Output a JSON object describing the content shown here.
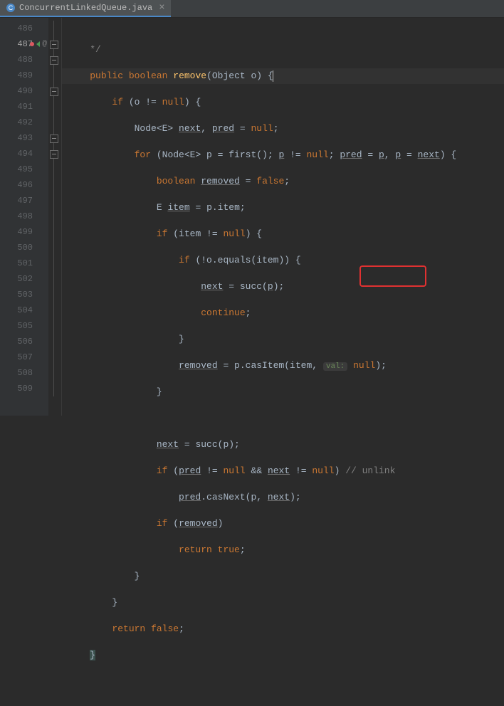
{
  "tab": {
    "filename": "ConcurrentLinkedQueue.java"
  },
  "gutter": {
    "start": 486,
    "end": 509,
    "highlight": 487
  },
  "code": {
    "l486": "*/",
    "l487_kw1": "public",
    "l487_kw2": "boolean",
    "l487_mtd": "remove",
    "l487_sig": "(Object o) {",
    "l488_kw": "if",
    "l488_cond": "(o != ",
    "l488_null": "null",
    "l488_end": ") {",
    "l489_ty": "Node<E>",
    "l489_v1": "next",
    "l489_v2": "pred",
    "l489_null": "null",
    "l490_kw": "for",
    "l490_ty": "Node<E>",
    "l490_rest1": " p = first(); ",
    "l490_p": "p",
    "l490_rest2": " != ",
    "l490_null": "null",
    "l490_rest3": "; ",
    "l490_pred": "pred",
    "l490_eq1": " = ",
    "l490_pval": "p",
    "l490_c2": ", ",
    "l490_pvar": "p",
    "l490_eq2": " = ",
    "l490_next": "next",
    "l490_end": ") {",
    "l491_kw": "boolean",
    "l491_v": "removed",
    "l491_false": "false",
    "l492_ty": "E",
    "l492_v": "item",
    "l492_rhs": " = p.item;",
    "l493_kw": "if",
    "l493_cond": "(item != ",
    "l493_null": "null",
    "l493_end": ") {",
    "l494_kw": "if",
    "l494_cond": "(!o.equals(item)) {",
    "l495_v": "next",
    "l495_rhs": " = succ(",
    "l495_p": "p",
    "l495_end": ");",
    "l496_kw": "continue",
    "l497": "}",
    "l498_v": "removed",
    "l498_rhs1": " = p.casItem(item, ",
    "l498_hint": "val:",
    "l498_null": "null",
    "l498_end": ");",
    "l499": "}",
    "l501_v": "next",
    "l501_rhs": " = succ(p);",
    "l502_kw": "if",
    "l502_o": "(",
    "l502_pred": "pred",
    "l502_r1": " != ",
    "l502_n1": "null",
    "l502_r2": " && ",
    "l502_next": "next",
    "l502_r3": " != ",
    "l502_n2": "null",
    "l502_end": ") ",
    "l502_cm": "// unlink",
    "l503_v": "pred",
    "l503_rhs": ".casNext(p, ",
    "l503_next": "next",
    "l503_end": ");",
    "l504_kw": "if",
    "l504_o": "(",
    "l504_v": "removed",
    "l504_end": ")",
    "l505_kw": "return",
    "l505_true": "true",
    "l506": "}",
    "l507": "}",
    "l508_kw": "return",
    "l508_false": "false",
    "l509": "}"
  },
  "annotation": {
    "comment": "unlink"
  }
}
